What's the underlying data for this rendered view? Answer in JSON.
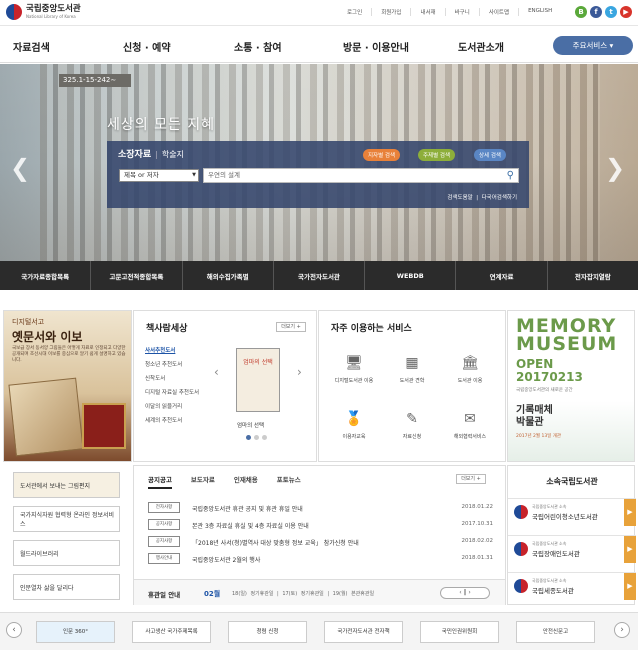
{
  "header": {
    "logo_ko": "국립중앙도서관",
    "logo_en": "National Library of Korea",
    "util_links": [
      "로그인",
      "회원가입",
      "내서재",
      "바구니",
      "사이트맵",
      "ENGLISH"
    ],
    "sns": [
      {
        "icon": "blog-icon",
        "glyph": "B",
        "color": "#5aa83a"
      },
      {
        "icon": "facebook-icon",
        "glyph": "f",
        "color": "#3b5998"
      },
      {
        "icon": "twitter-icon",
        "glyph": "t",
        "color": "#3aa6e0"
      },
      {
        "icon": "youtube-icon",
        "glyph": "▶",
        "color": "#d8342b"
      }
    ]
  },
  "gnb": {
    "menus": [
      "자료검색",
      "신청 · 예약",
      "소통 · 참여",
      "방문 · 이용안내",
      "도서관소개"
    ],
    "service_button": "주요서비스 ▾"
  },
  "hero": {
    "call_number": "325.1-15-242∼",
    "slogan": "세상의 모든 지혜",
    "search": {
      "tab_active": "소장자료",
      "tab_other": "학술지",
      "buttons": [
        {
          "label": "지자별 검색",
          "color": "#e8813a"
        },
        {
          "label": "주제별 검색",
          "color": "#8dae3a"
        },
        {
          "label": "상세 검색",
          "color": "#5a86c4"
        }
      ],
      "select_value": "제목 or 저자",
      "input_placeholder": "우연의 설계",
      "links": [
        "검색도움말",
        "다국어검색하기"
      ]
    }
  },
  "quick_links": [
    "국가자료종합목록",
    "고문고전적종합목록",
    "해외수집가족별",
    "국가전자도서관",
    "WEBDB",
    "연계자료",
    "전자잡지열람"
  ],
  "digital_archive": {
    "tag": "디지털서고",
    "title": "옛문서와 이보",
    "desc": "국보급 장서 동서양 그림들은 어떻게 자료로 인정되고 다양한 공개되며 조선시대 이보를 중심으로 알기 쉽게 설명하고 있습니다."
  },
  "books_world": {
    "title": "책사람세상",
    "more": "더보기 +",
    "list": [
      "사서추천도서",
      "청소년 추천도서",
      "신착도서",
      "디지털 자료실 추천도서",
      "이달의 읽을거리",
      "세계의 추천도서"
    ],
    "cover_title": "엄마의 선택",
    "caption": "엄마의 선택"
  },
  "frequent_services": {
    "title": "자주 이용하는 서비스",
    "items": [
      {
        "label": "디지털도서관 이용",
        "icon": "monitor-icon",
        "glyph": "🖥"
      },
      {
        "label": "도서관 견학",
        "icon": "calendar-icon",
        "glyph": "▦"
      },
      {
        "label": "도서관 이용",
        "icon": "building-icon",
        "glyph": "🏛"
      },
      {
        "label": "이용자교육",
        "icon": "certificate-icon",
        "glyph": "🏅"
      },
      {
        "label": "자료신청",
        "icon": "pen-icon",
        "glyph": "✎"
      },
      {
        "label": "해외협력서비스",
        "icon": "mail-icon",
        "glyph": "✉"
      }
    ]
  },
  "memory_museum": {
    "line1": "MEMORY",
    "line2": "MUSEUM",
    "open": "OPEN",
    "date": "20170213",
    "sub": "국립중앙도서관의 새로운 공간",
    "name1": "기록매체",
    "name2": "박물관",
    "note": "2017년 2월 13일 개관"
  },
  "side_banners": [
    {
      "label": "도서관에서 보내는 그림편지",
      "icon": "letter-icon"
    },
    {
      "label": "국가지식자원 협력형 온라인 정보서비스",
      "icon": "chat-icon"
    },
    {
      "label": "월드라이브러리",
      "icon": "globe-icon"
    },
    {
      "label": "인문열차 삶을 달리다",
      "icon": "train-icon"
    }
  ],
  "notice": {
    "tabs": [
      "공지공고",
      "보도자료",
      "인재채용",
      "포토뉴스"
    ],
    "more": "더보기 +",
    "rows": [
      {
        "tag": "전자사항",
        "text": "국립중앙도서관 휴관 공지 및 휴관 휴일 안내",
        "date": "2018.01.22"
      },
      {
        "tag": "공지사항",
        "text": "본관 3층 자료실 휴실 및 4층 자료실 이용 안내",
        "date": "2017.10.31"
      },
      {
        "tag": "공지사항",
        "text": "「2018년 사서(청)별역사 대상 맞춤형 정보 교육」 참가신청 안내",
        "date": "2018.02.02"
      },
      {
        "tag": "행사안내",
        "text": "국립중앙도서관 2월의 행사",
        "date": "2018.01.31"
      }
    ],
    "holiday_label": "휴관일 안내",
    "holiday_month": "02월",
    "holiday_days": "18(일) 정기휴관일 | 17(토) 정기휴관일 | 19(월) 본관휴관일",
    "holiday_ctl": "‹ ‖ ›"
  },
  "branches": {
    "title": "소속국립도서관",
    "items": [
      {
        "sub": "국립중앙도서관 소속",
        "name": "국립어린이청소년도서관"
      },
      {
        "sub": "국립중앙도서관 소속",
        "name": "국립장애인도서관"
      },
      {
        "sub": "국립중앙도서관 소속",
        "name": "국립세종도서관"
      }
    ]
  },
  "link_banners": [
    "인문 360°",
    "사고생산 국가주제목록",
    "청렴 신청",
    "국가전자도서관 전자책",
    "국민인권위원회",
    "안전신문고"
  ]
}
